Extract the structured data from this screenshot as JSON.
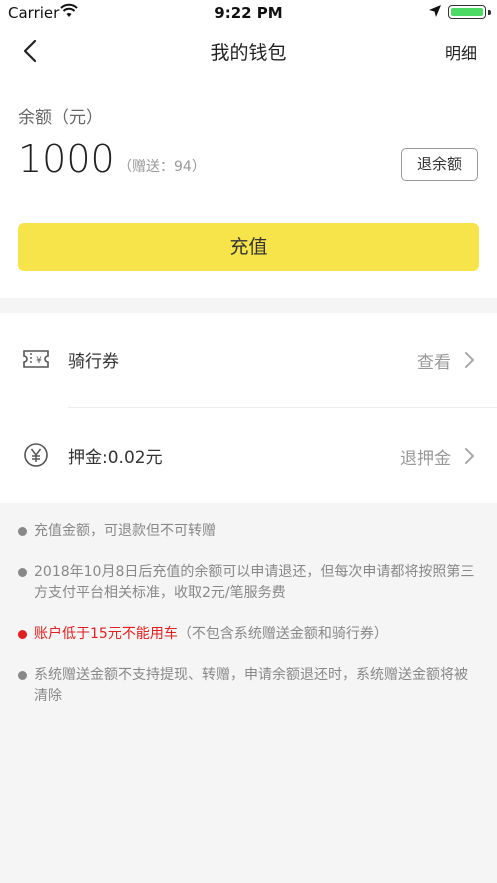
{
  "status": {
    "carrier": "Carrier",
    "time": "9:22 PM"
  },
  "nav": {
    "title": "我的钱包",
    "detail": "明细"
  },
  "balance": {
    "label": "余额（元）",
    "amount": "1000",
    "gift": "（赠送：94）",
    "refund_button": "退余额"
  },
  "recharge_button": "充值",
  "list": [
    {
      "label": "骑行券",
      "action": "查看",
      "icon": "ticket-icon"
    },
    {
      "label": "押金:0.02元",
      "action": "退押金",
      "icon": "yen-icon"
    }
  ],
  "notes": [
    {
      "text": "充值金额，可退款但不可转赠"
    },
    {
      "text": "2018年10月8日后充值的余额可以申请退还，但每次申请都将按照第三方支付平台相关标准，收取2元/笔服务费"
    },
    {
      "red": "账户低于15元不能用车",
      "text": "（不包含系统赠送金额和骑行券）"
    },
    {
      "text": "系统赠送金额不支持提现、转赠，申请余额退还时，系统赠送金额将被清除"
    }
  ],
  "colors": {
    "accent": "#f7e34a",
    "warning": "#e02020",
    "battery": "#4cd964"
  }
}
